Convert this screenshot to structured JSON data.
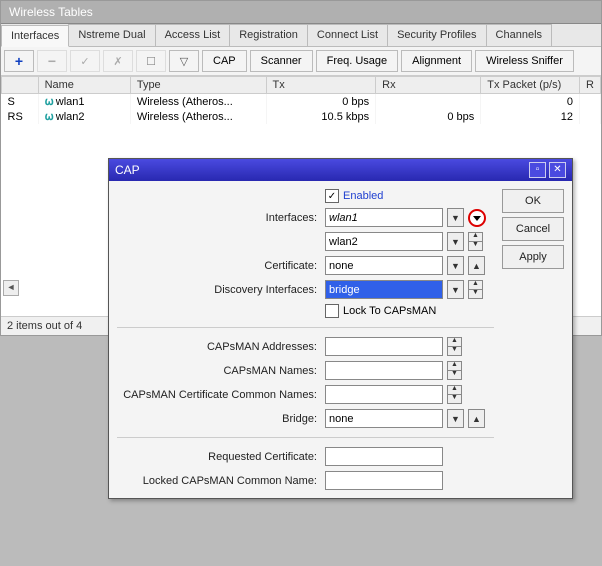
{
  "main_window": {
    "title": "Wireless Tables",
    "tabs": [
      "Interfaces",
      "Nstreme Dual",
      "Access List",
      "Registration",
      "Connect List",
      "Security Profiles",
      "Channels"
    ],
    "active_tab": 0,
    "toolbar": {
      "add": "+",
      "remove": "−",
      "enable": "✓",
      "disable": "✗",
      "comment": "☐",
      "filter": "▽",
      "cap": "CAP",
      "scanner": "Scanner",
      "freq": "Freq. Usage",
      "align": "Alignment",
      "sniffer": "Wireless Sniffer"
    },
    "columns": [
      "",
      "Name",
      "Type",
      "Tx",
      "Rx",
      "Tx Packet (p/s)",
      "R"
    ],
    "rows": [
      {
        "flag": "S",
        "name": "wlan1",
        "type": "Wireless (Atheros...",
        "tx": "0 bps",
        "rx": "",
        "txp": "0"
      },
      {
        "flag": "RS",
        "name": "wlan2",
        "type": "Wireless (Atheros...",
        "tx": "10.5 kbps",
        "rx": "0 bps",
        "txp": "12"
      }
    ],
    "status": "2 items out of 4"
  },
  "cap_dialog": {
    "title": "CAP",
    "enabled_label": "Enabled",
    "enabled_checked": true,
    "fields": {
      "interfaces_label": "Interfaces:",
      "interfaces1": "wlan1",
      "interfaces2": "wlan2",
      "certificate_label": "Certificate:",
      "certificate": "none",
      "discovery_label": "Discovery Interfaces:",
      "discovery": "bridge",
      "lock_label": "Lock To CAPsMAN",
      "lock_checked": false,
      "addresses_label": "CAPsMAN Addresses:",
      "addresses": "",
      "names_label": "CAPsMAN Names:",
      "names": "",
      "certnames_label": "CAPsMAN Certificate Common Names:",
      "certnames": "",
      "bridge_label": "Bridge:",
      "bridge": "none",
      "reqcert_label": "Requested Certificate:",
      "reqcert": "",
      "lockedcn_label": "Locked CAPsMAN Common Name:",
      "lockedcn": ""
    },
    "buttons": {
      "ok": "OK",
      "cancel": "Cancel",
      "apply": "Apply"
    }
  }
}
